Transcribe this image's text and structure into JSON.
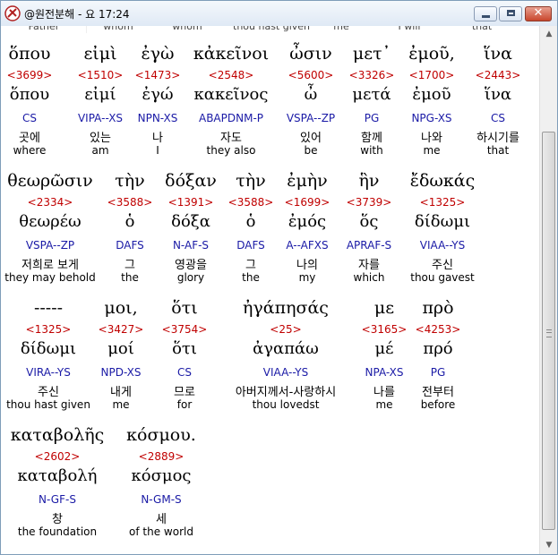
{
  "window": {
    "title": "@원전분해 - 요 17:24",
    "close_glyph": "✕"
  },
  "top_partial": [
    "Father",
    "whom",
    "whom",
    "thou hast given",
    "me",
    "I will",
    "that"
  ],
  "rows": [
    [
      {
        "greek": "ὅπου",
        "strong": "<3699>",
        "lemma": "ὅπου",
        "parse": "CS",
        "korean": "곳에",
        "english": "where"
      },
      {
        "greek": "εἰμὶ",
        "strong": "<1510>",
        "lemma": "εἰμί",
        "parse": "VIPA--XS",
        "korean": "있는",
        "english": "am"
      },
      {
        "greek": "ἐγὼ",
        "strong": "<1473>",
        "lemma": "ἐγώ",
        "parse": "NPN-XS",
        "korean": "나",
        "english": "I"
      },
      {
        "greek": "κἀκεῖνοι",
        "strong": "<2548>",
        "lemma": "κακεῖνος",
        "parse": "ABAPDNM-P",
        "korean": "자도",
        "english": "they also"
      },
      {
        "greek": "ὦσιν",
        "strong": "<5600>",
        "lemma": "ὦ",
        "parse": "VSPA--ZP",
        "korean": "있어",
        "english": "be"
      },
      {
        "greek": "μετ᾽",
        "strong": "<3326>",
        "lemma": "μετά",
        "parse": "PG",
        "korean": "함께",
        "english": "with"
      },
      {
        "greek": "ἐμοῦ,",
        "strong": "<1700>",
        "lemma": "ἐμοῦ",
        "parse": "NPG-XS",
        "korean": "나와",
        "english": "me"
      },
      {
        "greek": "ἵνα",
        "strong": "<2443>",
        "lemma": "ἵνα",
        "parse": "CS",
        "korean": "하시기를",
        "english": "that"
      }
    ],
    [
      {
        "greek": "θεωρῶσιν",
        "strong": "<2334>",
        "lemma": "θεωρέω",
        "parse": "VSPA--ZP",
        "korean": "저희로 보게",
        "english": "they may behold"
      },
      {
        "greek": "τὴν",
        "strong": "<3588>",
        "lemma": "ὁ",
        "parse": "DAFS",
        "korean": "그",
        "english": "the"
      },
      {
        "greek": "δόξαν",
        "strong": "<1391>",
        "lemma": "δόξα",
        "parse": "N-AF-S",
        "korean": "영광을",
        "english": "glory"
      },
      {
        "greek": "τὴν",
        "strong": "<3588>",
        "lemma": "ὁ",
        "parse": "DAFS",
        "korean": "그",
        "english": "the"
      },
      {
        "greek": "ἐμὴν",
        "strong": "<1699>",
        "lemma": "ἐμός",
        "parse": "A--AFXS",
        "korean": "나의",
        "english": "my"
      },
      {
        "greek": "ἣν",
        "strong": "<3739>",
        "lemma": "ὅς",
        "parse": "APRAF-S",
        "korean": "자를",
        "english": "which"
      },
      {
        "greek": "ἔδωκάς",
        "strong": "<1325>",
        "lemma": "δίδωμι",
        "parse": "VIAA--YS",
        "korean": "주신",
        "english": "thou gavest"
      }
    ],
    [
      {
        "greek": "-----",
        "strong": "<1325>",
        "lemma": "δίδωμι",
        "parse": "VIRA--YS",
        "korean": "주신",
        "english": "thou hast given"
      },
      {
        "greek": "μοι,",
        "strong": "<3427>",
        "lemma": "μοί",
        "parse": "NPD-XS",
        "korean": "내게",
        "english": "me"
      },
      {
        "greek": "ὅτι",
        "strong": "<3754>",
        "lemma": "ὅτι",
        "parse": "CS",
        "korean": "므로",
        "english": "for"
      },
      {
        "greek": "ἠγάπησάς",
        "strong": "<25>",
        "lemma": "ἀγαπάω",
        "parse": "VIAA--YS",
        "korean": "아버지께서-사랑하시",
        "english": "thou lovedst"
      },
      {
        "greek": "με",
        "strong": "<3165>",
        "lemma": "μέ",
        "parse": "NPA-XS",
        "korean": "나를",
        "english": "me"
      },
      {
        "greek": "πρὸ",
        "strong": "<4253>",
        "lemma": "πρό",
        "parse": "PG",
        "korean": "전부터",
        "english": "before"
      }
    ],
    [
      {
        "greek": "καταβολῆς",
        "strong": "<2602>",
        "lemma": "καταβολή",
        "parse": "N-GF-S",
        "korean": "창",
        "english": "the foundation"
      },
      {
        "greek": "κόσμου.",
        "strong": "<2889>",
        "lemma": "κόσμος",
        "parse": "N-GM-S",
        "korean": "세",
        "english": "of the world"
      }
    ]
  ]
}
